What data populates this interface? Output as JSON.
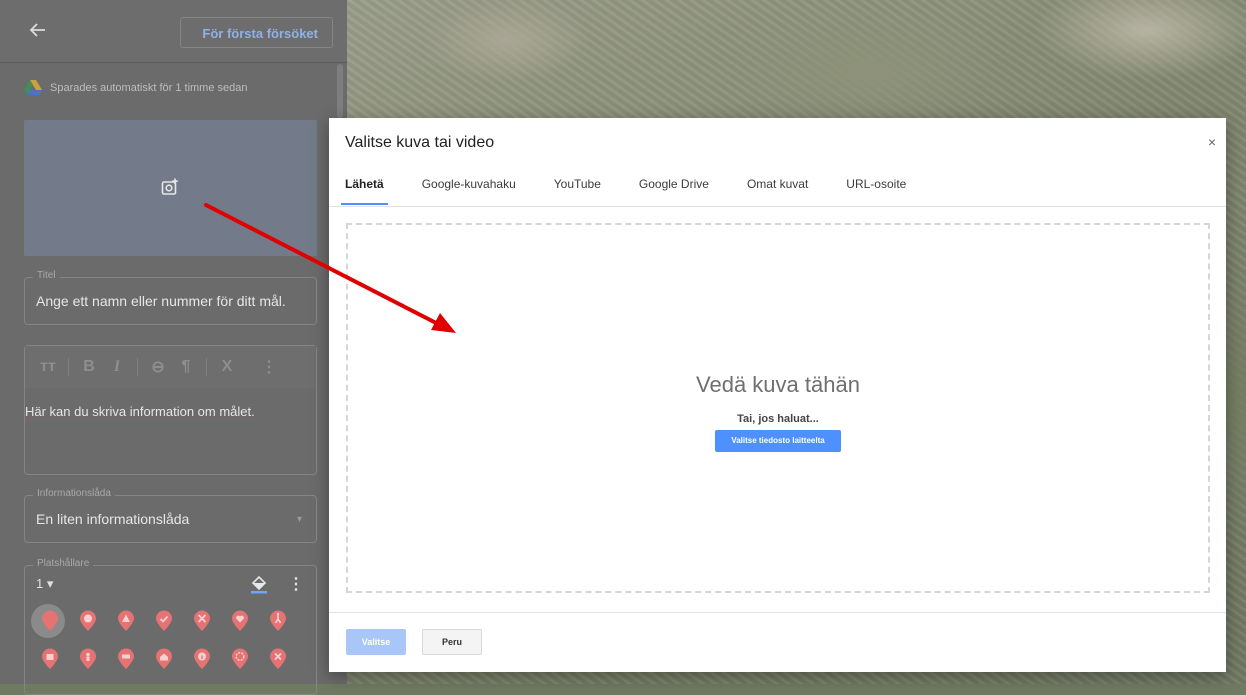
{
  "panel": {
    "back_icon": "arrow-left-icon",
    "first_attempt_label": "För första försöket",
    "autosave_text": "Sparades automatiskt för 1 timme sedan",
    "title_field": {
      "label": "Titel",
      "value": "Ange ett namn eller nummer för ditt mål."
    },
    "editor": {
      "text": "Här kan du skriva information om målet."
    },
    "infobox_field": {
      "label": "Informationslåda",
      "value": "En liten informationslåda"
    },
    "placeholder": {
      "label": "Platshållare",
      "number": "1"
    }
  },
  "modal": {
    "title": "Valitse kuva tai video",
    "close": "×",
    "tabs": [
      "Lähetä",
      "Google-kuvahaku",
      "YouTube",
      "Google Drive",
      "Omat kuvat",
      "URL-osoite"
    ],
    "active_tab": 0,
    "drop_title": "Vedä kuva tähän",
    "drop_or": "Tai, jos haluat...",
    "select_file_label": "Valitse tiedosto laitteelta",
    "choose_label": "Valitse",
    "cancel_label": "Peru"
  },
  "colors": {
    "accent": "#4d90fe",
    "pin": "#e57373",
    "annotation_arrow": "#e00000"
  }
}
